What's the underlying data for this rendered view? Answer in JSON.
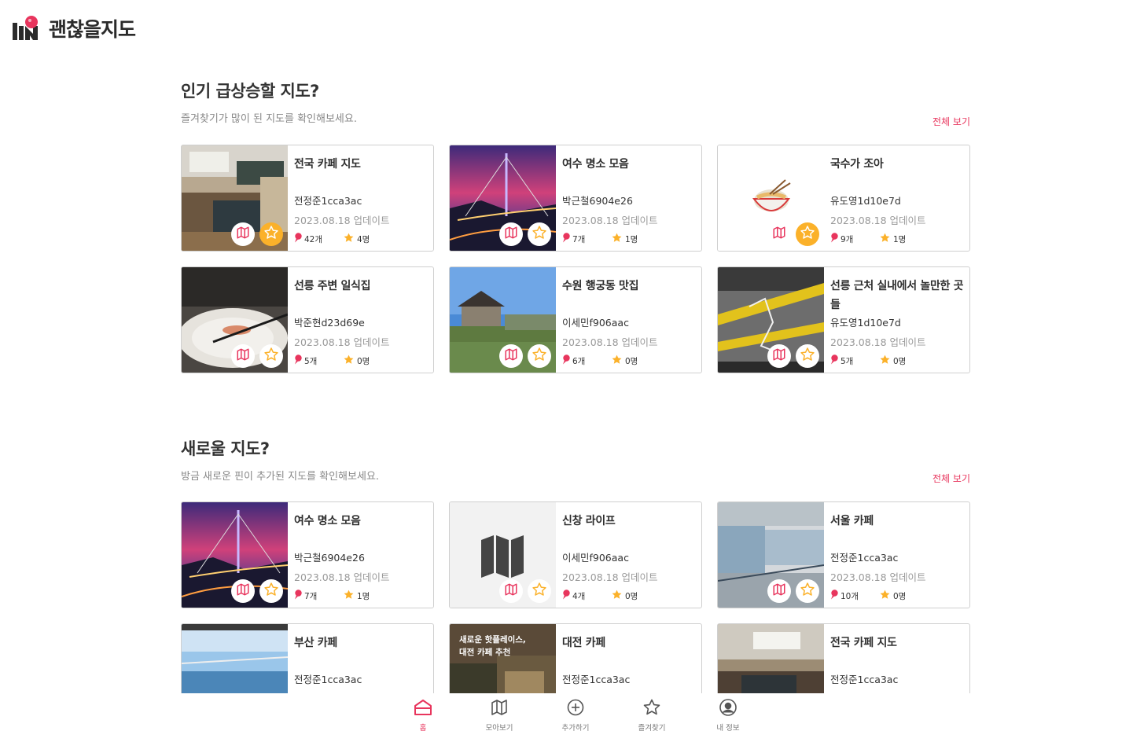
{
  "app": {
    "logo_text": "괜찮을지도"
  },
  "sections": [
    {
      "title": "인기 급상승할 지도?",
      "subtitle": "즐겨찾기가 많이 된 지도를 확인해보세요.",
      "view_all": "전체 보기",
      "cards": [
        {
          "title": "전국 카페 지도",
          "author": "전정준1cca3ac",
          "date": "2023.08.18 업데이트",
          "pins": "42개",
          "likes": "4명",
          "starred": true
        },
        {
          "title": "여수 명소 모음",
          "author": "박근철6904e26",
          "date": "2023.08.18 업데이트",
          "pins": "7개",
          "likes": "1명",
          "starred": false
        },
        {
          "title": "국수가 조아",
          "author": "유도영1d10e7d",
          "date": "2023.08.18 업데이트",
          "pins": "9개",
          "likes": "1명",
          "starred": true
        },
        {
          "title": "선릉 주변 일식집",
          "author": "박준현d23d69e",
          "date": "2023.08.18 업데이트",
          "pins": "5개",
          "likes": "0명",
          "starred": false
        },
        {
          "title": "수원 행궁동 맛집",
          "author": "이세민f906aac",
          "date": "2023.08.18 업데이트",
          "pins": "6개",
          "likes": "0명",
          "starred": false
        },
        {
          "title": "선릉 근처 실내에서 놀만한 곳들",
          "author": "유도영1d10e7d",
          "date": "2023.08.18 업데이트",
          "pins": "5개",
          "likes": "0명",
          "starred": false
        }
      ]
    },
    {
      "title": "새로울 지도?",
      "subtitle": "방금 새로운 핀이 추가된 지도를 확인해보세요.",
      "view_all": "전체 보기",
      "cards": [
        {
          "title": "여수 명소 모음",
          "author": "박근철6904e26",
          "date": "2023.08.18 업데이트",
          "pins": "7개",
          "likes": "1명",
          "starred": false
        },
        {
          "title": "신창 라이프",
          "author": "이세민f906aac",
          "date": "2023.08.18 업데이트",
          "pins": "4개",
          "likes": "0명",
          "starred": false
        },
        {
          "title": "서울 카페",
          "author": "전정준1cca3ac",
          "date": "2023.08.18 업데이트",
          "pins": "10개",
          "likes": "0명",
          "starred": false
        },
        {
          "title": "부산 카페",
          "author": "전정준1cca3ac"
        },
        {
          "title": "대전 카페",
          "author": "전정준1cca3ac",
          "thumb_caption": [
            "새로운 핫플레이스,",
            "대전 카페 추천"
          ]
        },
        {
          "title": "전국 카페 지도",
          "author": "전정준1cca3ac"
        }
      ]
    }
  ],
  "nav": [
    {
      "label": "홈",
      "icon": "home-icon",
      "active": true
    },
    {
      "label": "모아보기",
      "icon": "map-icon",
      "active": false
    },
    {
      "label": "추가하기",
      "icon": "plus-circle-icon",
      "active": false
    },
    {
      "label": "즐겨찾기",
      "icon": "star-icon",
      "active": false
    },
    {
      "label": "내 정보",
      "icon": "profile-icon",
      "active": false
    }
  ],
  "colors": {
    "accent": "#e8355d",
    "star": "#fbb12a",
    "border": "#cfcfcf"
  }
}
